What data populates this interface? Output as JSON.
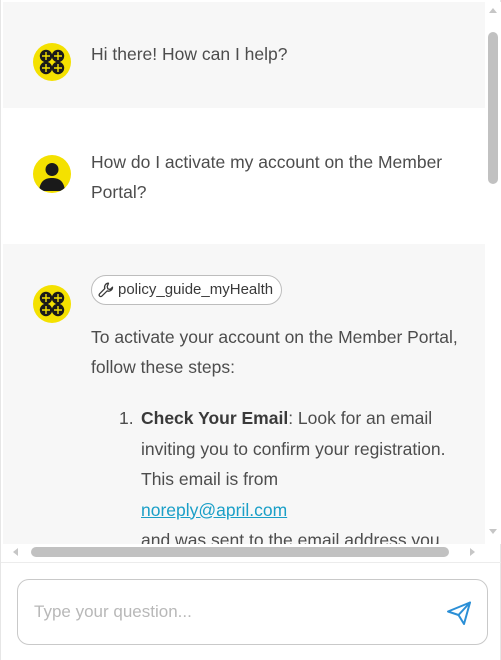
{
  "chat": {
    "messages": [
      {
        "role": "bot",
        "text": "Hi there! How can I help?"
      },
      {
        "role": "user",
        "text": "How do I activate my account on the Member Portal?"
      },
      {
        "role": "bot",
        "tool_chip": "policy_guide_myHealth",
        "intro": "To activate your account on the Member Portal, follow these steps:",
        "steps": [
          {
            "number": "1.",
            "title": "Check Your Email",
            "text_before_link": ": Look for an email inviting you to confirm your registration. This email is from",
            "link": "noreply@april.com",
            "text_after_link": "and was sent to the email address you"
          }
        ]
      }
    ]
  },
  "input": {
    "placeholder": "Type your question..."
  },
  "icons": {
    "bot_avatar": "bot-logo-icon",
    "user_avatar": "user-icon",
    "tool": "wrench-icon",
    "send": "send-icon"
  },
  "colors": {
    "avatar_bg": "#f4e100",
    "link": "#1a9fc7",
    "send_icon": "#2b8fd6",
    "bot_bubble_bg": "#f7f7f7"
  }
}
